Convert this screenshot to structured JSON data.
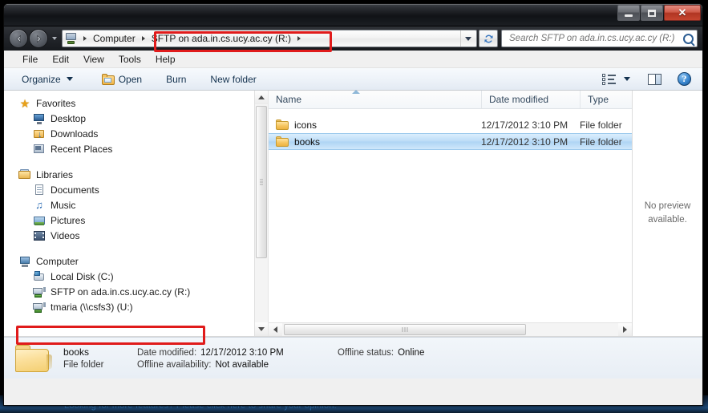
{
  "window": {
    "controls": {
      "minimize": "–",
      "maximize": "❑",
      "close": "✕"
    }
  },
  "navbar": {
    "back_label": "Back",
    "forward_label": "Forward",
    "recent_pages_label": "Recent pages",
    "breadcrumbs": [
      {
        "label": "Computer"
      },
      {
        "label": "SFTP on ada.in.cs.ucy.ac.cy (R:)"
      }
    ],
    "address_dropdown_label": "Previous locations",
    "refresh_label": "Refresh",
    "search": {
      "placeholder": "Search SFTP on ada.in.cs.ucy.ac.cy (R:)",
      "value": ""
    }
  },
  "menubar": {
    "items": [
      {
        "label": "File"
      },
      {
        "label": "Edit"
      },
      {
        "label": "View"
      },
      {
        "label": "Tools"
      },
      {
        "label": "Help"
      }
    ]
  },
  "toolbar": {
    "organize_label": "Organize",
    "open_label": "Open",
    "burn_label": "Burn",
    "new_folder_label": "New folder",
    "view_label": "Change your view",
    "preview_pane_label": "Show the preview pane",
    "help_label": "?"
  },
  "navpane": {
    "groups": [
      {
        "head": {
          "label": "Favorites",
          "icon": "star-icon"
        },
        "items": [
          {
            "label": "Desktop",
            "icon": "desktop-icon"
          },
          {
            "label": "Downloads",
            "icon": "downloads-icon"
          },
          {
            "label": "Recent Places",
            "icon": "recent-places-icon"
          }
        ]
      },
      {
        "head": {
          "label": "Libraries",
          "icon": "libraries-icon"
        },
        "items": [
          {
            "label": "Documents",
            "icon": "documents-icon"
          },
          {
            "label": "Music",
            "icon": "music-icon"
          },
          {
            "label": "Pictures",
            "icon": "pictures-icon"
          },
          {
            "label": "Videos",
            "icon": "videos-icon"
          }
        ]
      },
      {
        "head": {
          "label": "Computer",
          "icon": "computer-icon"
        },
        "items": [
          {
            "label": "Local Disk (C:)",
            "icon": "local-disk-icon"
          },
          {
            "label": "SFTP on ada.in.cs.ucy.ac.cy (R:)",
            "icon": "network-drive-icon"
          },
          {
            "label": "tmaria (\\\\csfs3) (U:)",
            "icon": "network-drive-icon"
          }
        ]
      }
    ]
  },
  "filelist": {
    "columns": [
      {
        "label": "Name",
        "sorted": "asc"
      },
      {
        "label": "Date modified"
      },
      {
        "label": "Type"
      }
    ],
    "rows": [
      {
        "name": "icons",
        "date": "12/17/2012 3:10 PM",
        "type": "File folder",
        "selected": false
      },
      {
        "name": "books",
        "date": "12/17/2012 3:10 PM",
        "type": "File folder",
        "selected": true
      }
    ]
  },
  "preview": {
    "message": "No preview available."
  },
  "details": {
    "name": "books",
    "kind": "File folder",
    "date_modified_label": "Date modified:",
    "date_modified_value": "12/17/2012 3:10 PM",
    "offline_status_label": "Offline status:",
    "offline_status_value": "Online",
    "offline_availability_label": "Offline availability:",
    "offline_availability_value": "Not available"
  },
  "desktop": {
    "ghost_text": "Looking for more features? Please click here to share your opinion."
  },
  "colors": {
    "annotation_red": "#e01b1b",
    "selection_blue": "#bcdcf7",
    "titlebar_dark": "#16191d",
    "close_red": "#b03522"
  }
}
